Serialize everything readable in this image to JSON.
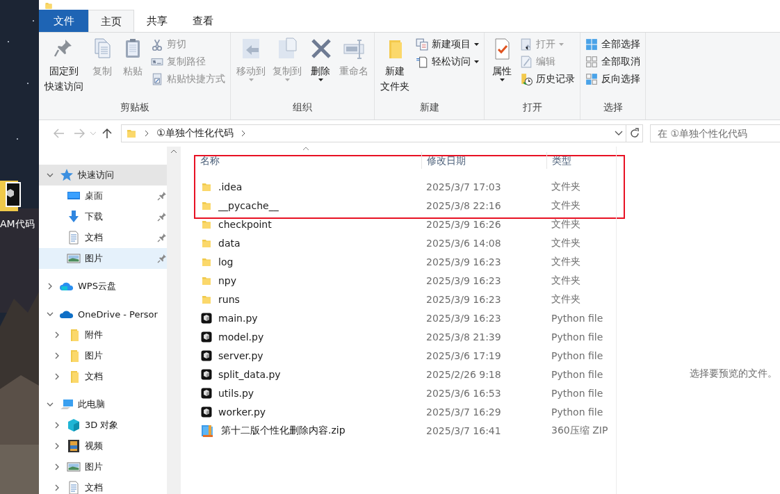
{
  "desktop": {
    "icon_label": "AM代码"
  },
  "ribbon": {
    "tabs": [
      {
        "label": "文件",
        "kind": "file",
        "selected": false
      },
      {
        "label": "主页",
        "kind": "tab",
        "selected": true
      },
      {
        "label": "共享",
        "kind": "tab",
        "selected": false
      },
      {
        "label": "查看",
        "kind": "tab",
        "selected": false
      }
    ],
    "groups": [
      {
        "label": "剪贴板",
        "items": [
          {
            "kind": "large",
            "lines": [
              "固定到",
              "快速访问"
            ],
            "disabled": false,
            "dropdown": false
          },
          {
            "kind": "large",
            "lines": [
              "复制"
            ],
            "disabled": true,
            "dropdown": false
          },
          {
            "kind": "large",
            "lines": [
              "粘贴"
            ],
            "disabled": true,
            "dropdown": false
          },
          {
            "kind": "stack",
            "items": [
              {
                "label": "剪切",
                "disabled": true,
                "dropdown": false
              },
              {
                "label": "复制路径",
                "disabled": true,
                "dropdown": false
              },
              {
                "label": "粘贴快捷方式",
                "disabled": true,
                "dropdown": false
              }
            ]
          }
        ]
      },
      {
        "label": "组织",
        "items": [
          {
            "kind": "large",
            "lines": [
              "移动到"
            ],
            "disabled": true,
            "dropdown": true
          },
          {
            "kind": "large",
            "lines": [
              "复制到"
            ],
            "disabled": true,
            "dropdown": true
          },
          {
            "kind": "large",
            "lines": [
              "删除"
            ],
            "disabled": false,
            "dropdown": true
          },
          {
            "kind": "large",
            "lines": [
              "重命名"
            ],
            "disabled": true,
            "dropdown": false
          }
        ]
      },
      {
        "label": "新建",
        "items": [
          {
            "kind": "large",
            "lines": [
              "新建",
              "文件夹"
            ],
            "disabled": false,
            "dropdown": false
          },
          {
            "kind": "stack",
            "items": [
              {
                "label": "新建项目",
                "disabled": false,
                "dropdown": true
              },
              {
                "label": "轻松访问",
                "disabled": false,
                "dropdown": true
              }
            ]
          }
        ]
      },
      {
        "label": "打开",
        "items": [
          {
            "kind": "large",
            "lines": [
              "属性"
            ],
            "disabled": false,
            "dropdown": true
          },
          {
            "kind": "stack",
            "items": [
              {
                "label": "打开",
                "disabled": true,
                "dropdown": true
              },
              {
                "label": "编辑",
                "disabled": true,
                "dropdown": false
              },
              {
                "label": "历史记录",
                "disabled": false,
                "dropdown": false
              }
            ]
          }
        ]
      },
      {
        "label": "选择",
        "items": [
          {
            "kind": "stack",
            "items": [
              {
                "label": "全部选择",
                "disabled": false,
                "dropdown": false
              },
              {
                "label": "全部取消",
                "disabled": false,
                "dropdown": false
              },
              {
                "label": "反向选择",
                "disabled": false,
                "dropdown": false
              }
            ]
          }
        ]
      }
    ]
  },
  "address": {
    "crumbs": [
      "①单独个性化代码"
    ],
    "search_placeholder": "在 ①单独个性化代码"
  },
  "navigation": [
    {
      "label": "快速访问",
      "expanded": true,
      "selected": true,
      "hovered": false,
      "children": [
        {
          "label": "桌面",
          "pinned": true,
          "selected": false,
          "hovered": false
        },
        {
          "label": "下载",
          "pinned": true,
          "selected": false,
          "hovered": false
        },
        {
          "label": "文档",
          "pinned": true,
          "selected": false,
          "hovered": false
        },
        {
          "label": "图片",
          "pinned": true,
          "selected": false,
          "hovered": true
        }
      ]
    },
    {
      "label": "WPS云盘",
      "expanded": false,
      "selected": false,
      "hovered": false
    },
    {
      "label": "OneDrive - Persor",
      "expanded": true,
      "selected": false,
      "hovered": false,
      "children": [
        {
          "label": "附件",
          "expanded": false,
          "selected": false,
          "hovered": false
        },
        {
          "label": "图片",
          "expanded": false,
          "selected": false,
          "hovered": false
        },
        {
          "label": "文档",
          "expanded": false,
          "selected": false,
          "hovered": false
        }
      ]
    },
    {
      "label": "此电脑",
      "expanded": true,
      "selected": false,
      "hovered": false,
      "children": [
        {
          "label": "3D 对象",
          "expanded": false,
          "selected": false,
          "hovered": false
        },
        {
          "label": "视频",
          "expanded": false,
          "selected": false,
          "hovered": false
        },
        {
          "label": "图片",
          "expanded": false,
          "selected": false,
          "hovered": false
        },
        {
          "label": "文档",
          "expanded": false,
          "selected": false,
          "hovered": false
        }
      ]
    }
  ],
  "file_list": {
    "columns": [
      {
        "label": "名称",
        "sorted": true
      },
      {
        "label": "修改日期",
        "sorted": false
      },
      {
        "label": "类型",
        "sorted": false
      }
    ],
    "row_groups": [
      {
        "framed": true,
        "rows": [
          {
            "kind": "folder",
            "name": ".idea",
            "modified": "2025/3/7 17:03",
            "type": "文件夹"
          },
          {
            "kind": "folder",
            "name": "__pycache__",
            "modified": "2025/3/8 22:16",
            "type": "文件夹"
          }
        ]
      },
      {
        "framed": false,
        "rows": [
          {
            "kind": "folder",
            "name": "checkpoint",
            "modified": "2025/3/9 16:26",
            "type": "文件夹"
          },
          {
            "kind": "folder",
            "name": "data",
            "modified": "2025/3/6 14:08",
            "type": "文件夹"
          },
          {
            "kind": "folder",
            "name": "log",
            "modified": "2025/3/9 16:23",
            "type": "文件夹"
          },
          {
            "kind": "folder",
            "name": "npy",
            "modified": "2025/3/9 16:23",
            "type": "文件夹"
          },
          {
            "kind": "folder",
            "name": "runs",
            "modified": "2025/3/9 16:23",
            "type": "文件夹"
          },
          {
            "kind": "python",
            "name": "main.py",
            "modified": "2025/3/9 16:23",
            "type": "Python file"
          },
          {
            "kind": "python",
            "name": "model.py",
            "modified": "2025/3/8 21:39",
            "type": "Python file"
          },
          {
            "kind": "python",
            "name": "server.py",
            "modified": "2025/3/6 17:19",
            "type": "Python file"
          },
          {
            "kind": "python",
            "name": "split_data.py",
            "modified": "2025/2/26 9:18",
            "type": "Python file"
          },
          {
            "kind": "python",
            "name": "utils.py",
            "modified": "2025/3/6 16:53",
            "type": "Python file"
          },
          {
            "kind": "python",
            "name": "worker.py",
            "modified": "2025/3/7 16:29",
            "type": "Python file"
          },
          {
            "kind": "zip",
            "name": "第十二版个性化删除内容.zip",
            "modified": "2025/3/7 16:41",
            "type": "360压缩 ZIP"
          }
        ]
      }
    ]
  },
  "preview": {
    "message": "选择要预览的文件。"
  }
}
